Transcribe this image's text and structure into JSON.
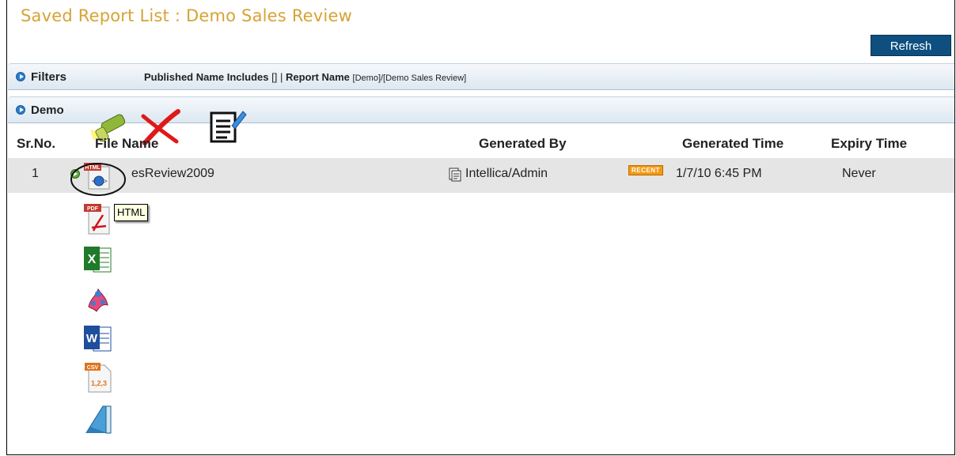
{
  "page": {
    "title": "Saved Report List : Demo Sales Review"
  },
  "toolbar": {
    "refresh_label": "Refresh"
  },
  "filters": {
    "label": "Filters",
    "published_prefix": "Published Name Includes",
    "published_value": "[]",
    "separator": "|",
    "report_prefix": "Report Name",
    "report_value": "[Demo]/[Demo Sales Review]"
  },
  "group": {
    "label": "Demo"
  },
  "table": {
    "columns": {
      "sr": "Sr.No.",
      "file": "File Name",
      "generated_by": "Generated By",
      "generated_time": "Generated Time",
      "expiry": "Expiry Time"
    },
    "rows": [
      {
        "sr": "1",
        "file_name": "esReview2009",
        "generated_by": "Intellica/Admin",
        "badge": "RECENT",
        "generated_time": "1/7/10 6:45 PM",
        "expiry": "Never"
      }
    ]
  },
  "tooltip": {
    "text": "HTML"
  },
  "icons": {
    "html_badge": "HTML",
    "pdf_badge": "PDF",
    "csv_badge": "CSV",
    "csv_body": "1,2,3"
  },
  "colors": {
    "title": "#d7a333",
    "refresh_bg": "#0e4f80",
    "badge": "#f39a14"
  }
}
